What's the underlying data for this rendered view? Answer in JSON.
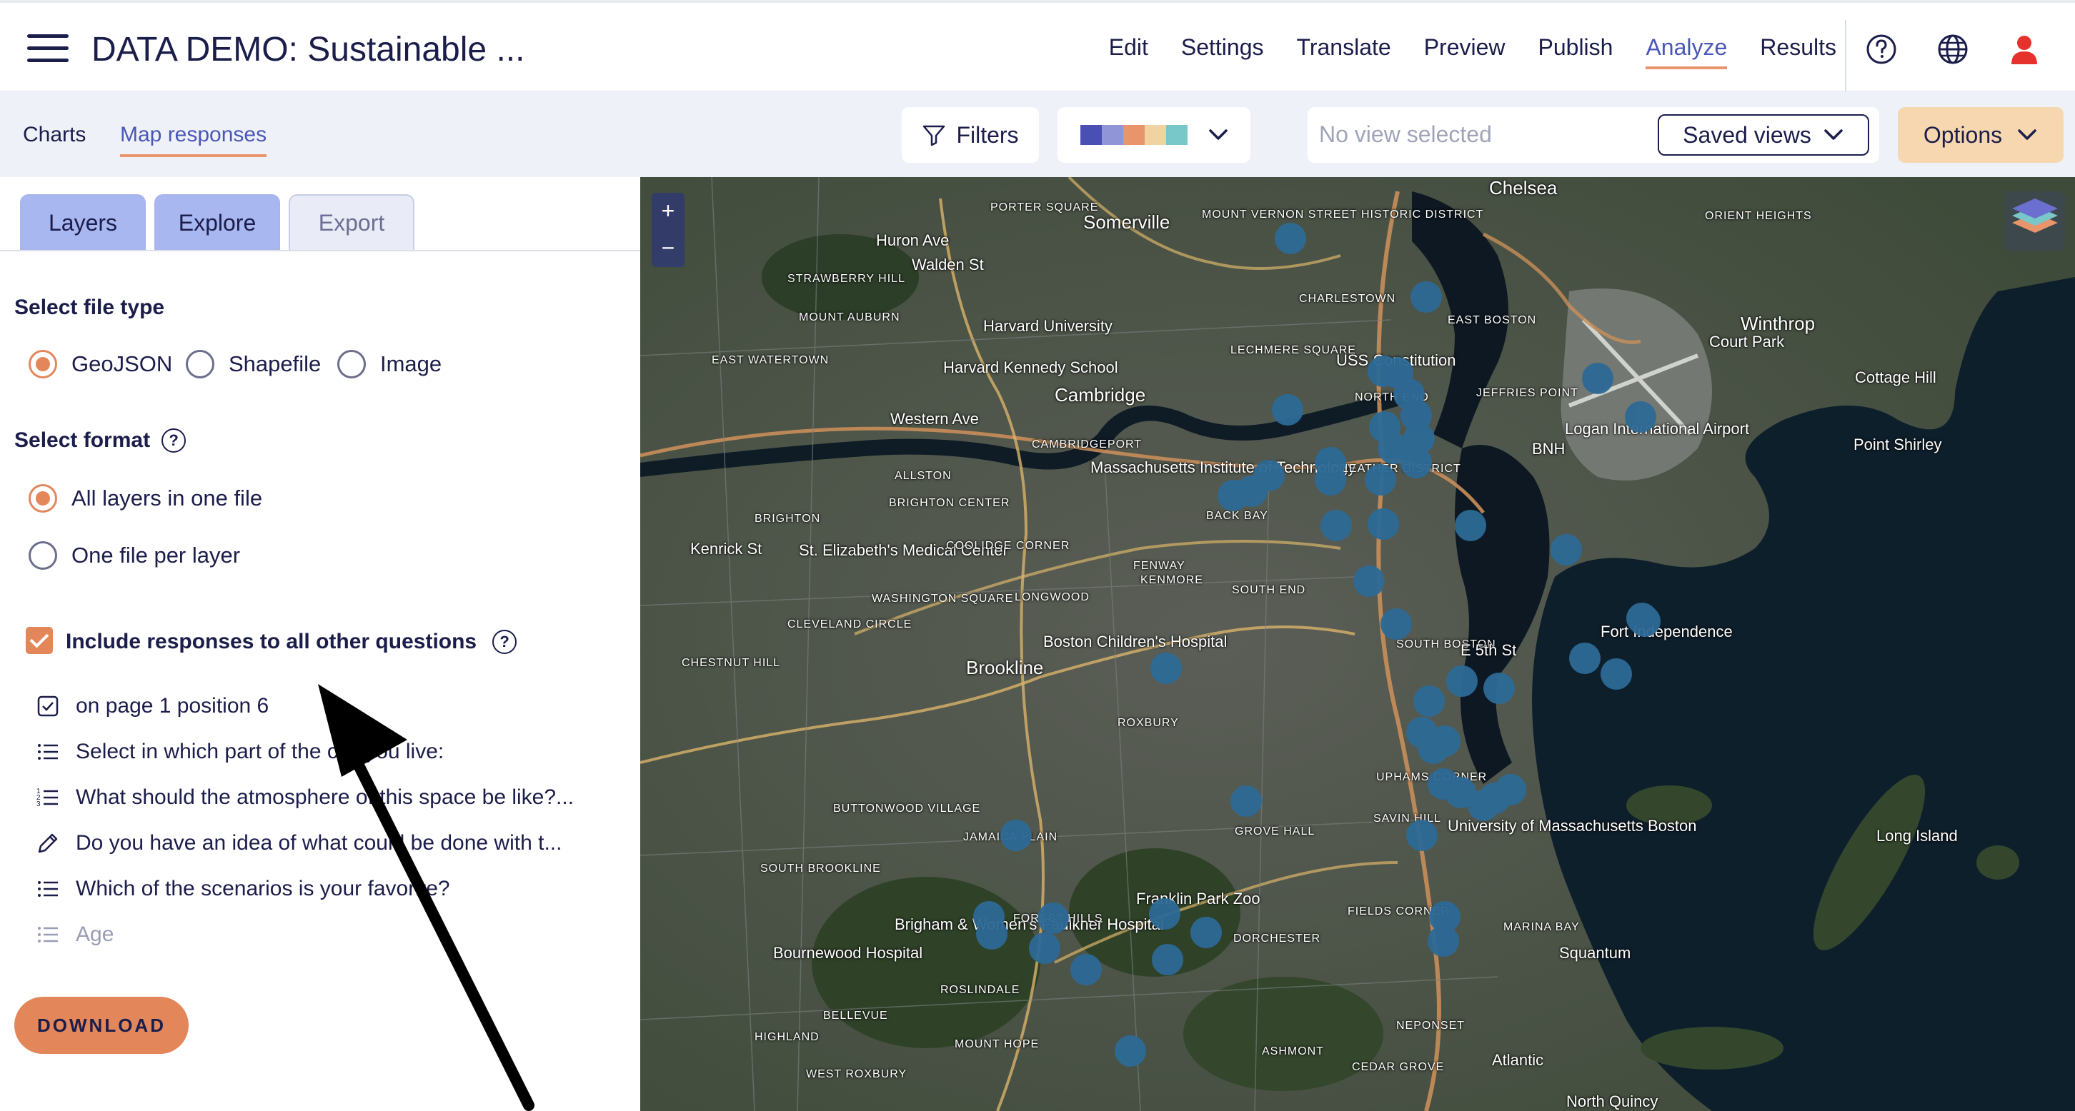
{
  "app": {
    "title": "DATA DEMO: Sustainable ..."
  },
  "nav": {
    "links": [
      "Edit",
      "Settings",
      "Translate",
      "Preview",
      "Publish",
      "Analyze",
      "Results"
    ],
    "active": "Analyze",
    "icons": [
      "help-icon",
      "globe-icon",
      "user-icon"
    ]
  },
  "subbar": {
    "tabs": [
      "Charts",
      "Map responses"
    ],
    "active_tab": "Map responses",
    "filters_label": "Filters",
    "palette_colors": [
      "#4a4fb3",
      "#8f95d6",
      "#e8956b",
      "#f1d3a3",
      "#78c7c9"
    ],
    "view_placeholder": "No view selected",
    "saved_views_label": "Saved views",
    "options_label": "Options"
  },
  "panel": {
    "tabs": [
      "Layers",
      "Explore",
      "Export"
    ],
    "active_tab": "Export",
    "file_type_label": "Select file type",
    "file_types": [
      "GeoJSON",
      "Shapefile",
      "Image"
    ],
    "file_type_selected": "GeoJSON",
    "format_label": "Select format",
    "formats": [
      "All layers in one file",
      "One file per layer"
    ],
    "format_selected": "All layers in one file",
    "include_label": "Include responses to all other questions",
    "include_checked": true,
    "questions": [
      {
        "text": "on page 1 position 6",
        "icon": "checkbox-icon"
      },
      {
        "text": "Select in which part of the city you live:",
        "icon": "list-icon"
      },
      {
        "text": "What should the atmosphere of this space be like?...",
        "icon": "ranked-list-icon"
      },
      {
        "text": "Do you have an idea of what could be done with t...",
        "icon": "pencil-icon"
      },
      {
        "text": "Which of the scenarios is your favorite?",
        "icon": "list-icon"
      },
      {
        "text": "Age",
        "icon": "list-icon"
      }
    ],
    "download_label": "DOWNLOAD"
  },
  "map": {
    "zoom_in": "+",
    "zoom_out": "−",
    "marker_color": "#2d6a96",
    "labels": [
      "Somerville",
      "Chelsea",
      "Cambridge",
      "Brookline",
      "Winthrop",
      "Harvard University",
      "Harvard Kennedy School",
      "Massachusetts Institute of Technology",
      "CHARLESTOWN",
      "EAST BOSTON",
      "JEFFRIES POINT",
      "BNH",
      "Logan International Airport",
      "Court Park",
      "Cottage Hill",
      "Point Shirley",
      "ORIENT HEIGHTS",
      "BACK BAY",
      "NORTH END",
      "LEATHER DISTRICT",
      "SOUTH END",
      "SOUTH BOSTON",
      "Fort Independence",
      "St. Elizabeth's Medical Center",
      "BRIGHTON",
      "ALLSTON",
      "Boston Children's Hospital",
      "ROXBURY",
      "KENMORE",
      "LONGWOOD",
      "FENWAY",
      "UPHAMS CORNER",
      "GROVE HALL",
      "SAVIN HILL",
      "University of Massachusetts Boston",
      "Franklin Park Zoo",
      "DORCHESTER",
      "Brigham & Women's Faulkner Hospital",
      "Bournewood Hospital",
      "ROSLINDALE",
      "HIGHLAND",
      "BELLEVUE",
      "WEST ROXBURY",
      "MOUNT HOPE",
      "ASHMONT",
      "NEPONSET",
      "CEDAR GROVE",
      "MARINA BAY",
      "Squantum",
      "North Quincy",
      "Atlantic",
      "FIELDS CORNER",
      "JAMAICA PLAIN",
      "FOREST HILLS",
      "CHESTNUT HILL",
      "CLEVELAND CIRCLE",
      "WASHINGTON SQUARE",
      "COOLIDGE CORNER",
      "BRIGHTON CENTER",
      "STRAWBERRY HILL",
      "MOUNT AUBURN",
      "EAST WATERTOWN",
      "PORTER SQUARE",
      "CAMBRIDGEPORT",
      "LECHMERE SQUARE",
      "MOUNT VERNON STREET HISTORIC DISTRICT",
      "USS Constitution",
      "BUTTONWOOD VILLAGE",
      "SOUTH BROOKLINE",
      "E 5th St",
      "Long Island",
      "Kenrick St",
      "Huron Ave",
      "Western Ave",
      "Walden St"
    ]
  }
}
